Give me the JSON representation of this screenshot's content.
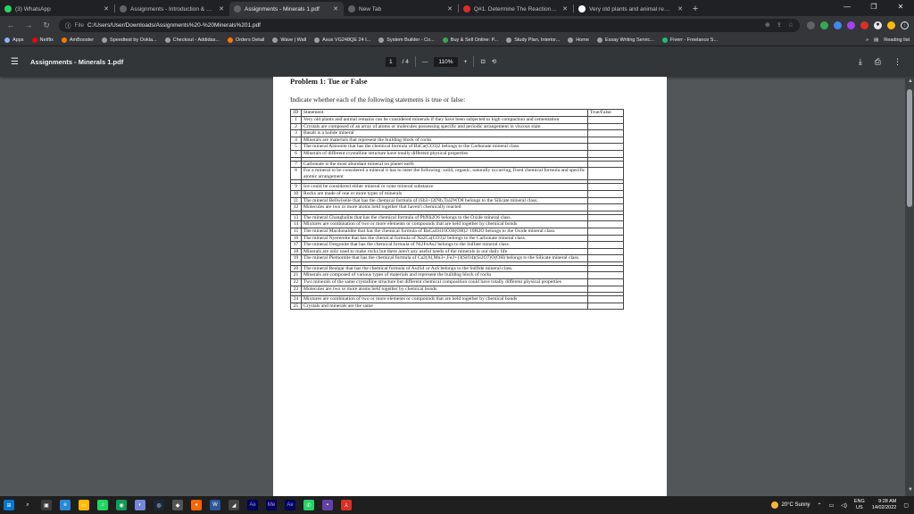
{
  "tabs": [
    {
      "label": "(3) WhatsApp",
      "color": "#25d366",
      "active": false
    },
    {
      "label": "Assignments - Introduction & Pr...",
      "color": "#5f6368",
      "active": false
    },
    {
      "label": "Assignments - Minerals 1.pdf",
      "color": "#5f6368",
      "active": true
    },
    {
      "label": "New Tab",
      "color": "#5f6368",
      "active": false
    },
    {
      "label": "Q#1. Determine The Reactions C...",
      "color": "#d93025",
      "active": false
    },
    {
      "label": "Very old plants and animal rema...",
      "color": "#ffffff",
      "active": false
    }
  ],
  "address": {
    "scheme": "File",
    "url": "C:/Users/User/Downloads/Assignments%20-%20Minerals%201.pdf"
  },
  "bookmarks": [
    {
      "label": "Apps",
      "color": "#8ab4f8"
    },
    {
      "label": "Netflix",
      "color": "#e50914"
    },
    {
      "label": "AmBooster",
      "color": "#f57c00"
    },
    {
      "label": "Speedtest by Ookla...",
      "color": "#9aa0a6"
    },
    {
      "label": "Checkout - Addidas...",
      "color": "#9aa0a6"
    },
    {
      "label": "Orders Detail",
      "color": "#f57c00"
    },
    {
      "label": "Wave | Wall",
      "color": "#9aa0a6"
    },
    {
      "label": "Asus VG248QE 24 I...",
      "color": "#9aa0a6"
    },
    {
      "label": "System Builder - Co...",
      "color": "#9aa0a6"
    },
    {
      "label": "Buy & Sell Online: P...",
      "color": "#34a853"
    },
    {
      "label": "Study Plan, Interior...",
      "color": "#9aa0a6"
    },
    {
      "label": "Home",
      "color": "#9aa0a6"
    },
    {
      "label": "Essay Writing Servic...",
      "color": "#9aa0a6"
    },
    {
      "label": "Fiverr - Freelance S...",
      "color": "#1dbf73"
    }
  ],
  "bookmarks_more": "»",
  "reading_list": "Reading list",
  "pdf": {
    "title": "Assignments - Minerals 1.pdf",
    "page_current": "1",
    "page_total": "/ 4",
    "zoom": "110%",
    "minus": "—",
    "plus": "+"
  },
  "doc": {
    "problem_title": "Problem 1: Tue or False",
    "instruction": "Indicate whether each of the following statements is true or false:",
    "col_id": "ID",
    "col_statement": "Statement",
    "col_tf": "True/False",
    "rows": [
      {
        "id": "1",
        "text": "Very old plants and animal remains can be considered minerals if they have been subjected to high compaction and cementation"
      },
      {
        "id": "2",
        "text": "Crystals are composed of an array of atoms or molecules possessing specific and periodic arrangement in viscous state"
      },
      {
        "id": "3",
        "text": "Basalt is a halide mineral"
      },
      {
        "id": "4",
        "text": "Minerals are materials that represent the building block of rocks"
      },
      {
        "id": "5",
        "text": "The mineral Alstonite that has the chemical formula of BaCa(CO3)2 belongs to the Carbonate mineral class."
      },
      {
        "id": "6",
        "text": "Minerals of different crystalline structure have totally different physical properties",
        "gap_after": true
      },
      {
        "id": "7",
        "text": "Carbonate is the most abundant mineral on planet earth"
      },
      {
        "id": "8",
        "text": "For a mineral to be considered a mineral it has to meet the following: solid, organic, naturally occurring, fixed chemical formula and specific atomic arrangement",
        "gap_after": true
      },
      {
        "id": "9",
        "text": "Ice could be considered either mineral or none mineral substance"
      },
      {
        "id": "10",
        "text": "Rocks are made of one or more types of minerals"
      },
      {
        "id": "11",
        "text": "The mineral Bellwiseite that has the chemical formula of (Sb3+)2(Nb,Ta)2WO8 belongs to the Silicate mineral class."
      },
      {
        "id": "12",
        "text": "Molecules are two or more atoms held together that haven't chemically reacted",
        "gap_after": true
      },
      {
        "id": "13",
        "text": "The mineral Changbaiite that has the chemical formula of PbNb2O6 belongs to the Oxide mineral class."
      },
      {
        "id": "14",
        "text": "Mixtures are combination of two or more elements or compounds that are held together by chemical bonds"
      },
      {
        "id": "15",
        "text": "The mineral Macdonaldite that has the chemical formula of BaCa4Si16O36(OH)2·10H2O belongs to the Oxide mineral class."
      },
      {
        "id": "16",
        "text": "The mineral Nyerereite that has the chemical formula of Na2Ca(CO3)2 belongs to the Carbonate mineral class."
      },
      {
        "id": "17",
        "text": "The mineral Oregonite that has the chemical formula of Ni2FeAs2 belongs to the Sulfate mineral class."
      },
      {
        "id": "18",
        "text": "Minerals are only used to make rocks but there aren't any useful needs of the minerals in our daily life"
      },
      {
        "id": "19",
        "text": "The mineral Piemontite that has the chemical formula of Ca2(Al,Mn3+,Fe3+)3(SiO4)(Si2O7)O(OH) belongs to the Silicate mineral class.",
        "gap_after": true
      },
      {
        "id": "20",
        "text": "The mineral Realgar that has the chemical formula of As4S4 or AsS belongs to the Sulfide mineral class."
      },
      {
        "id": "21",
        "text": "Minerals are composed of various types of materials and represent the building block of rocks"
      },
      {
        "id": "22",
        "text": "Two minerals of the same crystalline structure but different chemical composition could have totally different physical properties"
      },
      {
        "id": "23",
        "text": "Molecules are two or more atoms held together by chemical bonds",
        "gap_after": true
      },
      {
        "id": "24",
        "text": "Mixtures are combination of two or more elements or compounds that are held together by chemical bonds"
      },
      {
        "id": "25",
        "text": "Crystals and minerals are the same"
      }
    ]
  },
  "taskbar": {
    "weather": "20°C Sunny",
    "lang_top": "ENG",
    "lang_bottom": "US",
    "time": "9:28 AM",
    "date": "14/02/2022"
  }
}
